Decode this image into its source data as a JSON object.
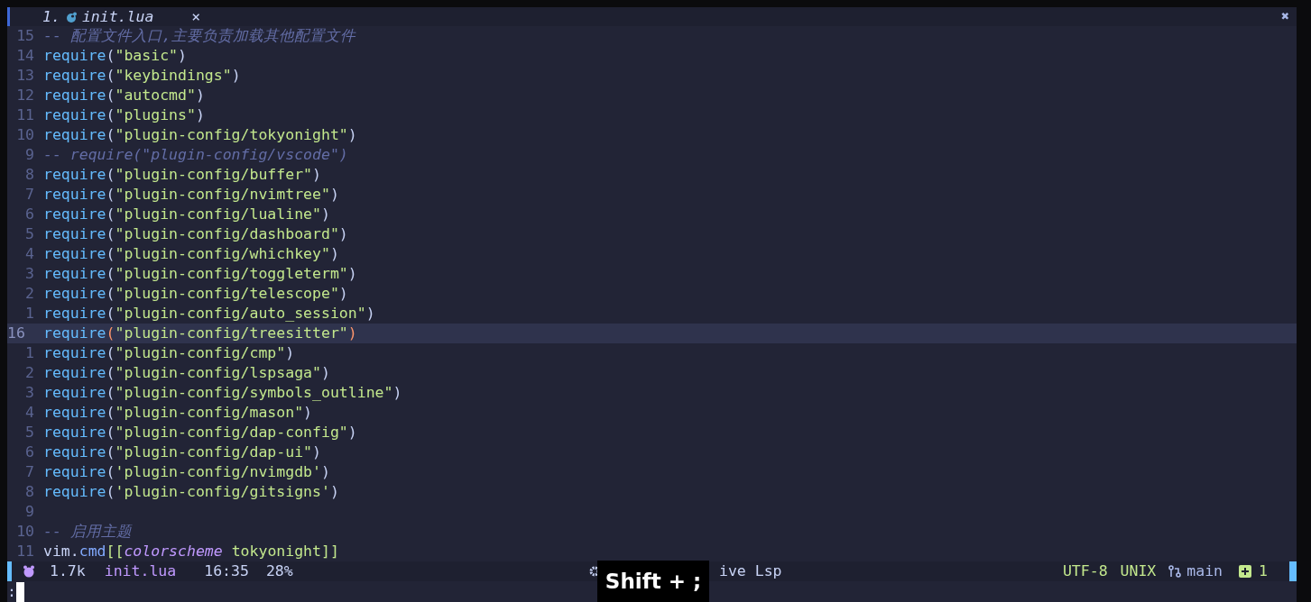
{
  "tab": {
    "index": "1.",
    "title": "init.lua",
    "close": "×",
    "selected": true
  },
  "window_close": "✖",
  "lines": [
    {
      "number": "15",
      "current": false,
      "tokens": [
        {
          "kind": "comment",
          "text": "-- 配置文件入口,主要负责加载其他配置文件"
        }
      ]
    },
    {
      "number": "14",
      "current": false,
      "tokens": [
        {
          "kind": "func",
          "text": "require"
        },
        {
          "kind": "paren",
          "text": "("
        },
        {
          "kind": "string",
          "text": "\"basic\""
        },
        {
          "kind": "paren",
          "text": ")"
        }
      ]
    },
    {
      "number": "13",
      "current": false,
      "tokens": [
        {
          "kind": "func",
          "text": "require"
        },
        {
          "kind": "paren",
          "text": "("
        },
        {
          "kind": "string",
          "text": "\"keybindings\""
        },
        {
          "kind": "paren",
          "text": ")"
        }
      ]
    },
    {
      "number": "12",
      "current": false,
      "tokens": [
        {
          "kind": "func",
          "text": "require"
        },
        {
          "kind": "paren",
          "text": "("
        },
        {
          "kind": "string",
          "text": "\"autocmd\""
        },
        {
          "kind": "paren",
          "text": ")"
        }
      ]
    },
    {
      "number": "11",
      "current": false,
      "tokens": [
        {
          "kind": "func",
          "text": "require"
        },
        {
          "kind": "paren",
          "text": "("
        },
        {
          "kind": "string",
          "text": "\"plugins\""
        },
        {
          "kind": "paren",
          "text": ")"
        }
      ]
    },
    {
      "number": "10",
      "current": false,
      "tokens": [
        {
          "kind": "func",
          "text": "require"
        },
        {
          "kind": "paren",
          "text": "("
        },
        {
          "kind": "string",
          "text": "\"plugin-config/tokyonight\""
        },
        {
          "kind": "paren",
          "text": ")"
        }
      ]
    },
    {
      "number": "9",
      "current": false,
      "tokens": [
        {
          "kind": "comment",
          "text": "-- require(\"plugin-config/vscode\")"
        }
      ]
    },
    {
      "number": "8",
      "current": false,
      "tokens": [
        {
          "kind": "func",
          "text": "require"
        },
        {
          "kind": "paren",
          "text": "("
        },
        {
          "kind": "string",
          "text": "\"plugin-config/buffer\""
        },
        {
          "kind": "paren",
          "text": ")"
        }
      ]
    },
    {
      "number": "7",
      "current": false,
      "tokens": [
        {
          "kind": "func",
          "text": "require"
        },
        {
          "kind": "paren",
          "text": "("
        },
        {
          "kind": "string",
          "text": "\"plugin-config/nvimtree\""
        },
        {
          "kind": "paren",
          "text": ")"
        }
      ]
    },
    {
      "number": "6",
      "current": false,
      "tokens": [
        {
          "kind": "func",
          "text": "require"
        },
        {
          "kind": "paren",
          "text": "("
        },
        {
          "kind": "string",
          "text": "\"plugin-config/lualine\""
        },
        {
          "kind": "paren",
          "text": ")"
        }
      ]
    },
    {
      "number": "5",
      "current": false,
      "tokens": [
        {
          "kind": "func",
          "text": "require"
        },
        {
          "kind": "paren",
          "text": "("
        },
        {
          "kind": "string",
          "text": "\"plugin-config/dashboard\""
        },
        {
          "kind": "paren",
          "text": ")"
        }
      ]
    },
    {
      "number": "4",
      "current": false,
      "tokens": [
        {
          "kind": "func",
          "text": "require"
        },
        {
          "kind": "paren",
          "text": "("
        },
        {
          "kind": "string",
          "text": "\"plugin-config/whichkey\""
        },
        {
          "kind": "paren",
          "text": ")"
        }
      ]
    },
    {
      "number": "3",
      "current": false,
      "tokens": [
        {
          "kind": "func",
          "text": "require"
        },
        {
          "kind": "paren",
          "text": "("
        },
        {
          "kind": "string",
          "text": "\"plugin-config/toggleterm\""
        },
        {
          "kind": "paren",
          "text": ")"
        }
      ]
    },
    {
      "number": "2",
      "current": false,
      "tokens": [
        {
          "kind": "func",
          "text": "require"
        },
        {
          "kind": "paren",
          "text": "("
        },
        {
          "kind": "string",
          "text": "\"plugin-config/telescope\""
        },
        {
          "kind": "paren",
          "text": ")"
        }
      ]
    },
    {
      "number": "1",
      "current": false,
      "tokens": [
        {
          "kind": "func",
          "text": "require"
        },
        {
          "kind": "paren",
          "text": "("
        },
        {
          "kind": "string",
          "text": "\"plugin-config/auto_session\""
        },
        {
          "kind": "paren",
          "text": ")"
        }
      ]
    },
    {
      "number": "16",
      "current": true,
      "tokens": [
        {
          "kind": "func",
          "text": "require"
        },
        {
          "kind": "match_paren",
          "text": "("
        },
        {
          "kind": "string",
          "text": "\"plugin-config/treesitter\""
        },
        {
          "kind": "match_paren",
          "text": ")"
        }
      ]
    },
    {
      "number": "1",
      "current": false,
      "tokens": [
        {
          "kind": "func",
          "text": "require"
        },
        {
          "kind": "paren",
          "text": "("
        },
        {
          "kind": "string",
          "text": "\"plugin-config/cmp\""
        },
        {
          "kind": "paren",
          "text": ")"
        }
      ]
    },
    {
      "number": "2",
      "current": false,
      "tokens": [
        {
          "kind": "func",
          "text": "require"
        },
        {
          "kind": "paren",
          "text": "("
        },
        {
          "kind": "string",
          "text": "\"plugin-config/lspsaga\""
        },
        {
          "kind": "paren",
          "text": ")"
        }
      ]
    },
    {
      "number": "3",
      "current": false,
      "tokens": [
        {
          "kind": "func",
          "text": "require"
        },
        {
          "kind": "paren",
          "text": "("
        },
        {
          "kind": "string",
          "text": "\"plugin-config/symbols_outline\""
        },
        {
          "kind": "paren",
          "text": ")"
        }
      ]
    },
    {
      "number": "4",
      "current": false,
      "tokens": [
        {
          "kind": "func",
          "text": "require"
        },
        {
          "kind": "paren",
          "text": "("
        },
        {
          "kind": "string",
          "text": "\"plugin-config/mason\""
        },
        {
          "kind": "paren",
          "text": ")"
        }
      ]
    },
    {
      "number": "5",
      "current": false,
      "tokens": [
        {
          "kind": "func",
          "text": "require"
        },
        {
          "kind": "paren",
          "text": "("
        },
        {
          "kind": "string",
          "text": "\"plugin-config/dap-config\""
        },
        {
          "kind": "paren",
          "text": ")"
        }
      ]
    },
    {
      "number": "6",
      "current": false,
      "tokens": [
        {
          "kind": "func",
          "text": "require"
        },
        {
          "kind": "paren",
          "text": "("
        },
        {
          "kind": "string",
          "text": "\"plugin-config/dap-ui\""
        },
        {
          "kind": "paren",
          "text": ")"
        }
      ]
    },
    {
      "number": "7",
      "current": false,
      "tokens": [
        {
          "kind": "func",
          "text": "require"
        },
        {
          "kind": "paren",
          "text": "("
        },
        {
          "kind": "string",
          "text": "'plugin-config/nvimgdb'"
        },
        {
          "kind": "paren",
          "text": ")"
        }
      ]
    },
    {
      "number": "8",
      "current": false,
      "tokens": [
        {
          "kind": "func",
          "text": "require"
        },
        {
          "kind": "paren",
          "text": "("
        },
        {
          "kind": "string",
          "text": "'plugin-config/gitsigns'"
        },
        {
          "kind": "paren",
          "text": ")"
        }
      ]
    },
    {
      "number": "9",
      "current": false
    },
    {
      "number": "10",
      "current": false,
      "tokens": [
        {
          "kind": "comment",
          "text": "-- 启用主题"
        }
      ]
    },
    {
      "number": "11",
      "current": false,
      "tokens": [
        {
          "kind": "plain",
          "text": "vim."
        },
        {
          "kind": "field",
          "text": "cmd"
        },
        {
          "kind": "string",
          "text": "[["
        },
        {
          "kind": "keyword",
          "text": "colorscheme"
        },
        {
          "kind": "string",
          "text": " tokyonight]]"
        }
      ]
    }
  ],
  "status_bar": {
    "left": [
      {
        "kind": "size",
        "text": "1.7k"
      },
      {
        "kind": "filename",
        "text": "init.lua"
      },
      {
        "kind": "position",
        "text": "16:35"
      },
      {
        "kind": "percent",
        "text": "28%"
      }
    ],
    "lsp": "ive Lsp",
    "right": [
      {
        "kind": "encoding",
        "text": "UTF-8"
      },
      {
        "kind": "format",
        "text": "UNIX"
      },
      {
        "kind": "branch",
        "text": "main"
      },
      {
        "kind": "added",
        "text": "1"
      }
    ]
  },
  "command_line": {
    "text": ":"
  },
  "keystroke_overlay": "Shift + ;"
}
